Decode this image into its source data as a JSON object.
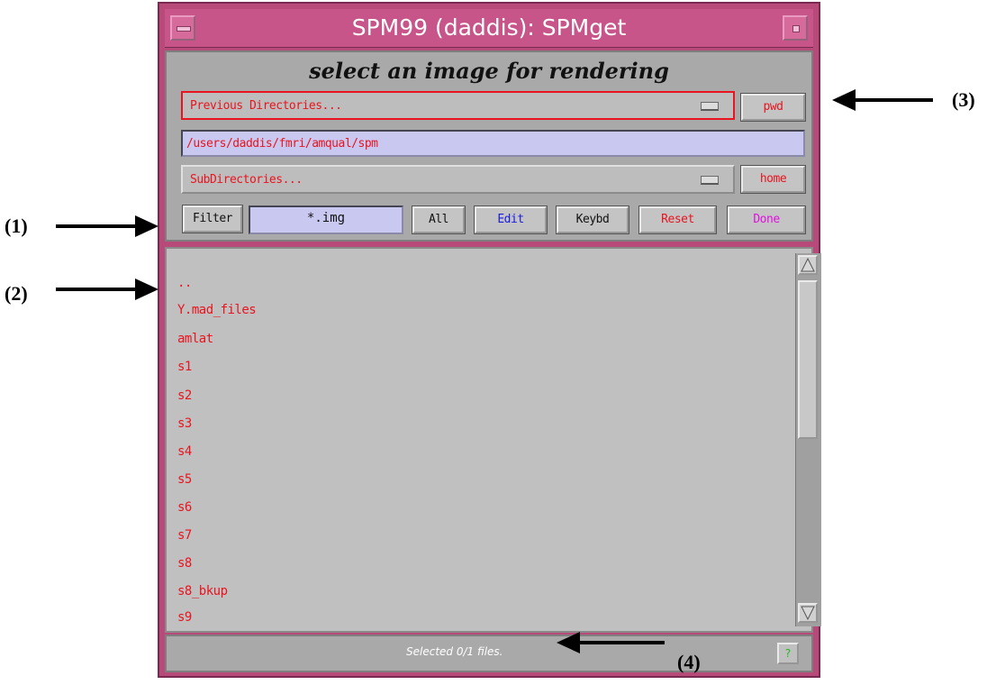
{
  "window": {
    "title": "SPM99 (daddis): SPMget",
    "heading": "select an image for rendering",
    "previous_directories": "Previous Directories...",
    "path": "/users/daddis/fmri/amqual/spm",
    "subdirectories": "SubDirectories...",
    "buttons": {
      "pwd": "pwd",
      "home": "home",
      "filter": "Filter",
      "all": "All",
      "edit": "Edit",
      "keybd": "Keybd",
      "reset": "Reset",
      "done": "Done"
    },
    "filter_value": "*.img",
    "list_items": [
      "..",
      "Y.mad_files",
      "amlat",
      "s1",
      "s2",
      "s3",
      "s4",
      "s5",
      "s6",
      "s7",
      "s8",
      "s8_bkup",
      "s9"
    ],
    "status": "Selected 0/1 files.",
    "help_label": "?"
  },
  "annotations": {
    "label_1": "(1)",
    "label_2": "(2)",
    "label_3": "(3)",
    "label_4": "(4)"
  },
  "colors": {
    "title_bar": "#c8558a",
    "panel": "#a9a9a9",
    "list_text": "#e8141f",
    "field_bg": "#c8c8f0",
    "edit_text": "#1a1ae0",
    "reset_text": "#e8141f",
    "done_text": "#e010e0",
    "help_text": "#22bb22"
  },
  "icons": {
    "title_left": "window-menu-icon",
    "title_right": "maximize-icon",
    "dropdown": "option-menu-indicator-icon",
    "scroll_up": "scroll-up-arrow-icon",
    "scroll_down": "scroll-down-arrow-icon",
    "annotation_arrow": "arrow-icon"
  }
}
